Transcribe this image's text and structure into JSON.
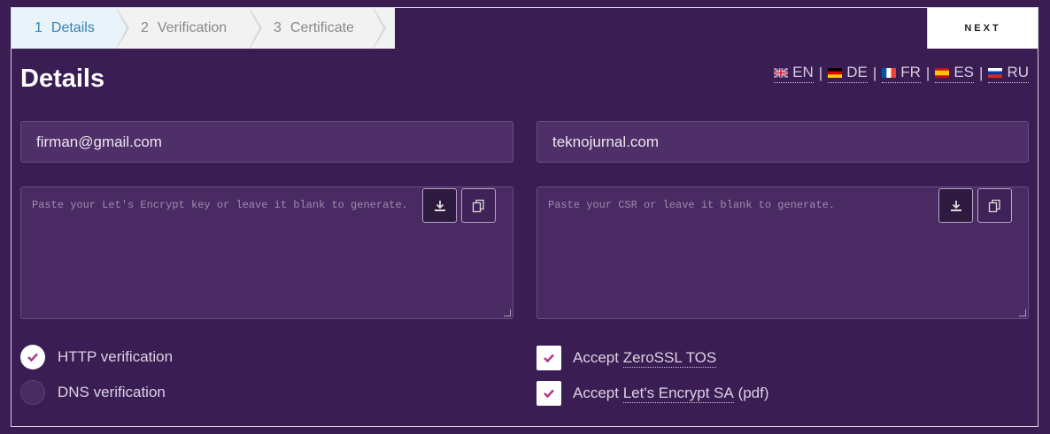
{
  "steps": [
    {
      "number": "1",
      "label": "Details"
    },
    {
      "number": "2",
      "label": "Verification"
    },
    {
      "number": "3",
      "label": "Certificate"
    }
  ],
  "next_label": "NEXT",
  "page_title": "Details",
  "languages": [
    "EN",
    "DE",
    "FR",
    "ES",
    "RU"
  ],
  "email_value": "firman@gmail.com",
  "domain_value": "teknojurnal.com",
  "key_placeholder": "Paste your Let's Encrypt key or leave it blank to generate.",
  "csr_placeholder": "Paste your CSR or leave it blank to generate.",
  "verification": {
    "http_label": "HTTP verification",
    "http_selected": true,
    "dns_label": "DNS verification",
    "dns_selected": false
  },
  "agreements": {
    "tos_prefix": "Accept ",
    "tos_link": "ZeroSSL TOS",
    "tos_checked": true,
    "sa_prefix": "Accept ",
    "sa_link": "Let's Encrypt SA",
    "sa_suffix": " (pdf)",
    "sa_checked": true
  },
  "colors": {
    "background": "#3a1d52",
    "accent": "#b03a8c",
    "active_step": "#3a82b5"
  }
}
